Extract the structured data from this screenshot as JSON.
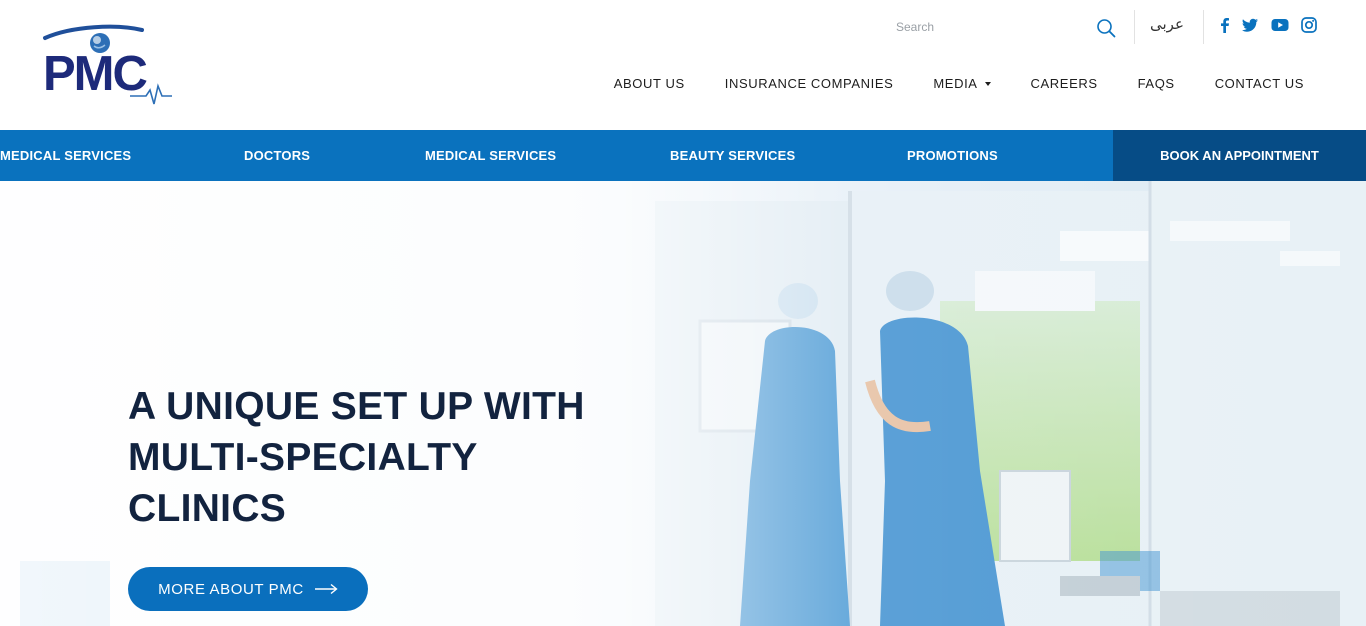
{
  "brand": {
    "logo_text": "PMC",
    "color_primary": "#0a72be",
    "color_dark": "#064c86",
    "color_heading": "#12233f"
  },
  "header": {
    "search_placeholder": "Search",
    "language_link": "عربى",
    "social": [
      "facebook-icon",
      "twitter-icon",
      "youtube-icon",
      "instagram-icon"
    ],
    "nav": [
      {
        "label": "ABOUT US"
      },
      {
        "label": "INSURANCE COMPANIES"
      },
      {
        "label": "MEDIA",
        "dropdown": true
      },
      {
        "label": "CAREERS"
      },
      {
        "label": "FAQS"
      },
      {
        "label": "CONTACT US"
      }
    ]
  },
  "servicebar": {
    "items": [
      {
        "label": "MEDICAL SERVICES"
      },
      {
        "label": "DOCTORS"
      },
      {
        "label": "MEDICAL SERVICES"
      },
      {
        "label": "BEAUTY SERVICES"
      },
      {
        "label": "PROMOTIONS"
      }
    ],
    "book_label": "BOOK AN APPOINTMENT"
  },
  "hero": {
    "title_lines": [
      "A UNIQUE SET UP WITH",
      "MULTI-SPECIALTY",
      "CLINICS"
    ],
    "cta_label": "MORE ABOUT PMC"
  }
}
